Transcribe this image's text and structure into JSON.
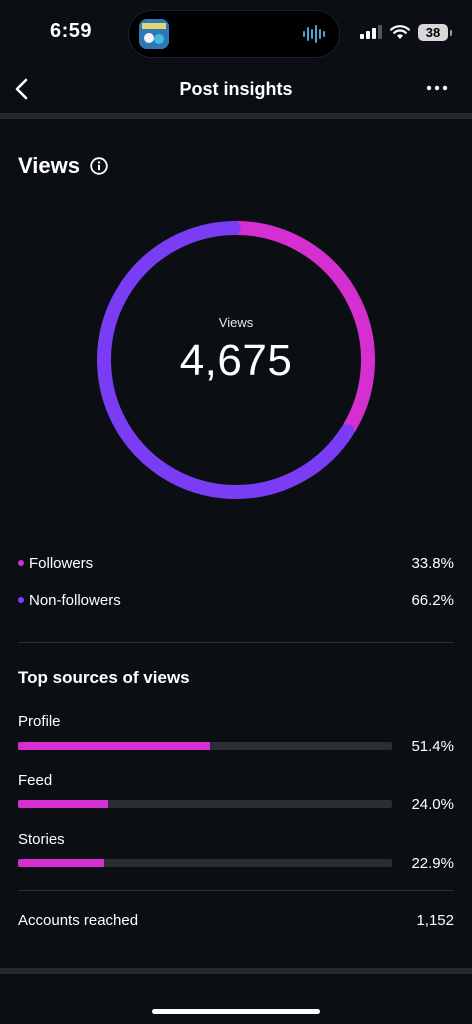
{
  "status_bar": {
    "time": "6:59",
    "battery": "38"
  },
  "header": {
    "title": "Post insights"
  },
  "views": {
    "section_title": "Views",
    "center_label": "Views",
    "total": "4,675",
    "legend": [
      {
        "label": "Followers",
        "value": "33.8%",
        "color": "#d62fd1"
      },
      {
        "label": "Non-followers",
        "value": "66.2%",
        "color": "#7b3cf5"
      }
    ]
  },
  "chart_data": {
    "type": "pie",
    "categories": [
      "Followers",
      "Non-followers"
    ],
    "values": [
      33.8,
      66.2
    ],
    "colors": [
      "#d62fd1",
      "#7b3cf5"
    ],
    "title": "Views"
  },
  "top_sources": {
    "title": "Top sources of views",
    "items": [
      {
        "label": "Profile",
        "value": "51.4%",
        "fraction": 0.514
      },
      {
        "label": "Feed",
        "value": "24.0%",
        "fraction": 0.24
      },
      {
        "label": "Stories",
        "value": "22.9%",
        "fraction": 0.229
      }
    ]
  },
  "accounts_reached": {
    "label": "Accounts reached",
    "value": "1,152"
  },
  "icons": [
    "back-arrow-icon",
    "more-options-icon",
    "info-icon",
    "signal-icon",
    "wifi-icon",
    "battery-icon",
    "audio-wave-icon"
  ]
}
